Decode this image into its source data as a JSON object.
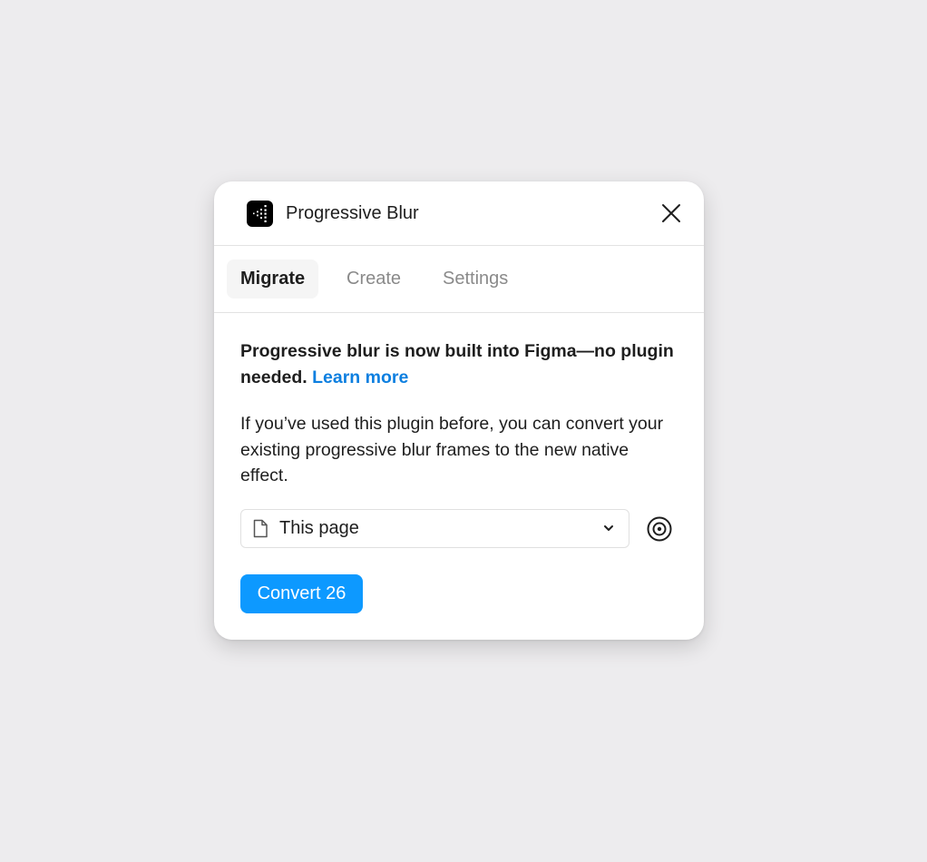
{
  "window": {
    "title": "Progressive Blur",
    "app_icon": "progressive-blur-dots-icon",
    "close_icon": "close-icon"
  },
  "tabs": [
    {
      "label": "Migrate",
      "active": true
    },
    {
      "label": "Create",
      "active": false
    },
    {
      "label": "Settings",
      "active": false
    }
  ],
  "migrate": {
    "headline": "Progressive blur is now built into Figma—no plugin needed.",
    "learn_more": "Learn more",
    "description": "If you’ve used this plugin before, you can convert your existing progressive blur frames to the new native effect.",
    "scope_select": {
      "icon": "file-icon",
      "value": "This page",
      "chevron_icon": "chevron-down-icon"
    },
    "target_icon": "target-icon",
    "convert_label": "Convert 26"
  },
  "colors": {
    "accent": "#0d99ff",
    "link": "#0d7fe0",
    "background": "#edecee",
    "panel": "#ffffff"
  }
}
